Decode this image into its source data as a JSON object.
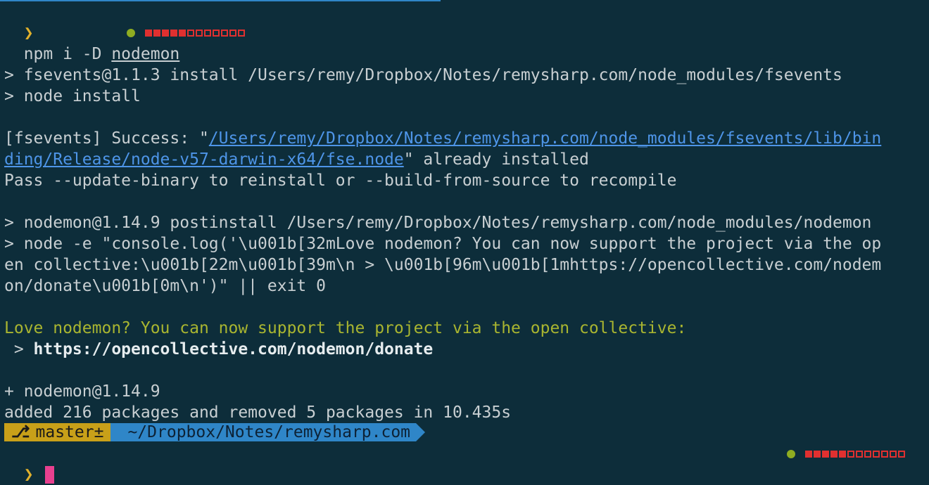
{
  "terminal": {
    "prompt_symbol": "❯",
    "command_prefix": "npm i -D ",
    "command_package": "nodemon",
    "fsevents_install": "> fsevents@1.1.3 install /Users/remy/Dropbox/Notes/remysharp.com/node_modules/fsevents",
    "fsevents_node_install": "> node install",
    "success_prefix": "[fsevents] Success: \"",
    "success_path_1": "/Users/remy/Dropbox/Notes/remysharp.com/node_modules/fsevents/lib/bin",
    "success_path_2": "ding/Release/node-v57-darwin-x64/fse.node",
    "success_suffix": "\" already installed",
    "pass_hint": "Pass --update-binary to reinstall or --build-from-source to recompile",
    "nodemon_postinstall": "> nodemon@1.14.9 postinstall /Users/remy/Dropbox/Notes/remysharp.com/node_modules/nodemon",
    "node_e_1": "> node -e \"console.log('\\u001b[32mLove nodemon? You can now support the project via the op",
    "node_e_2": "en collective:\\u001b[22m\\u001b[39m\\n > \\u001b[96m\\u001b[1mhttps://opencollective.com/nodem",
    "node_e_3": "on/donate\\u001b[0m\\n')\" || exit 0",
    "love_message": "Love nodemon? You can now support the project via the open collective:",
    "donate_prefix": " > ",
    "donate_url": "https://opencollective.com/nodemon/donate",
    "added_pkg": "+ nodemon@1.14.9",
    "summary": "added 216 packages and removed 5 packages in 10.435s"
  },
  "powerline": {
    "branch_icon": "⎇",
    "branch": "master±",
    "path": "~/Dropbox/Notes/remysharp.com"
  },
  "activity_indicator": {
    "filled_segments": 5,
    "total_segments": 12
  },
  "colors": {
    "background": "#0d2d3a",
    "prompt": "#e1b12c",
    "link": "#4e95e8",
    "highlight_text": "#a9b530",
    "branch_segment": "#c8a019",
    "path_segment": "#2f86c8",
    "cursor": "#e8408f",
    "indicator_red": "#e03030"
  }
}
